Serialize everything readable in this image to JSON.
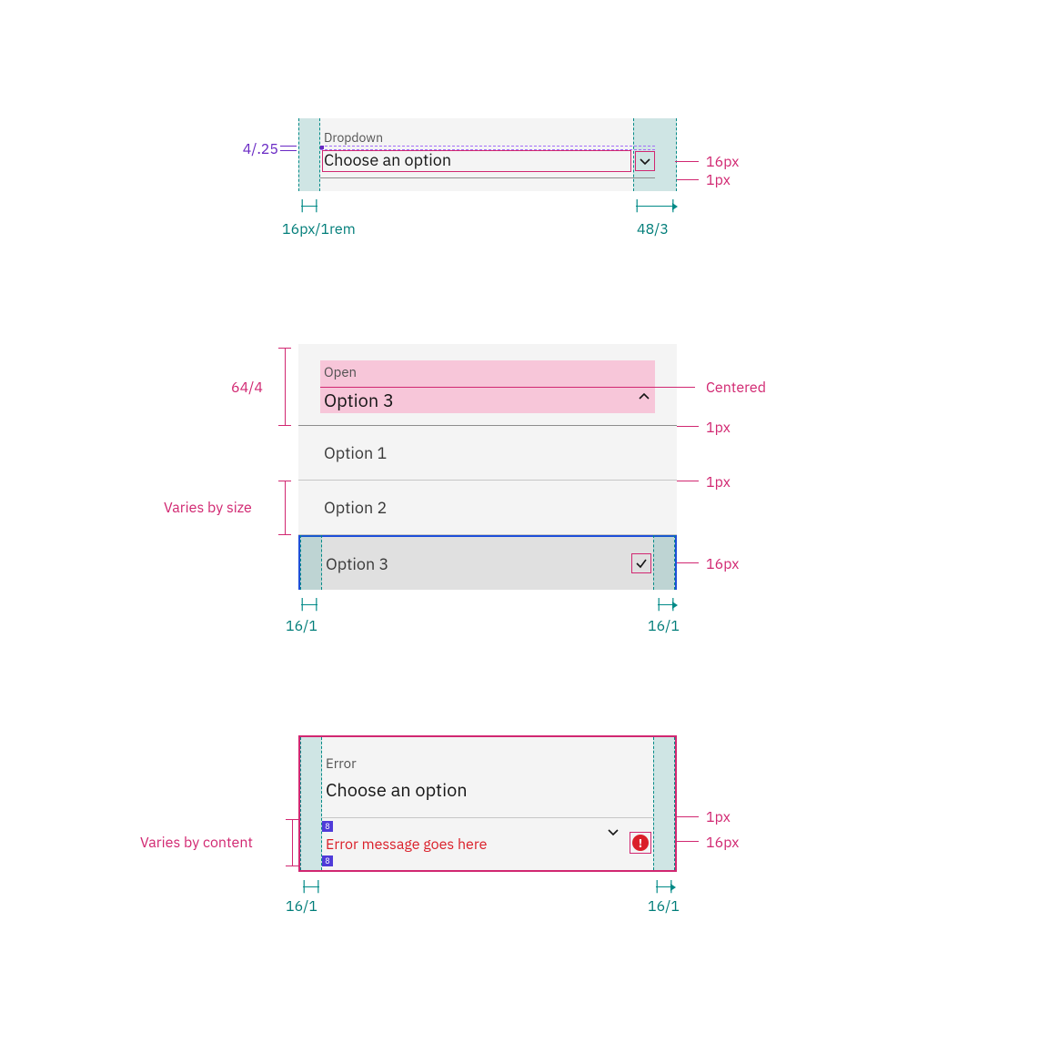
{
  "figure1": {
    "label": "Dropdown",
    "placeholder": "Choose an option",
    "gap_label": "4/.25",
    "icon_size": "16px",
    "border_size": "1px",
    "left_pad": "16px/1rem",
    "right_pad": "48/3"
  },
  "figure2": {
    "header_label": "Open",
    "header_value": "Option 3",
    "header_height": "64/4",
    "centered_label": "Centered",
    "divider_size": "1px",
    "row_divider": "1px",
    "row_height_label": "Varies by size",
    "options": [
      "Option 1",
      "Option 2",
      "Option 3"
    ],
    "check_size": "16px",
    "left_pad": "16/1",
    "right_pad": "16/1"
  },
  "figure3": {
    "label": "Error",
    "placeholder": "Choose an option",
    "error_text": "Error message goes here",
    "row_label": "Varies by content",
    "divider_size": "1px",
    "icon_size": "16px",
    "spacer": "8",
    "left_pad": "16/1",
    "right_pad": "16/1"
  }
}
